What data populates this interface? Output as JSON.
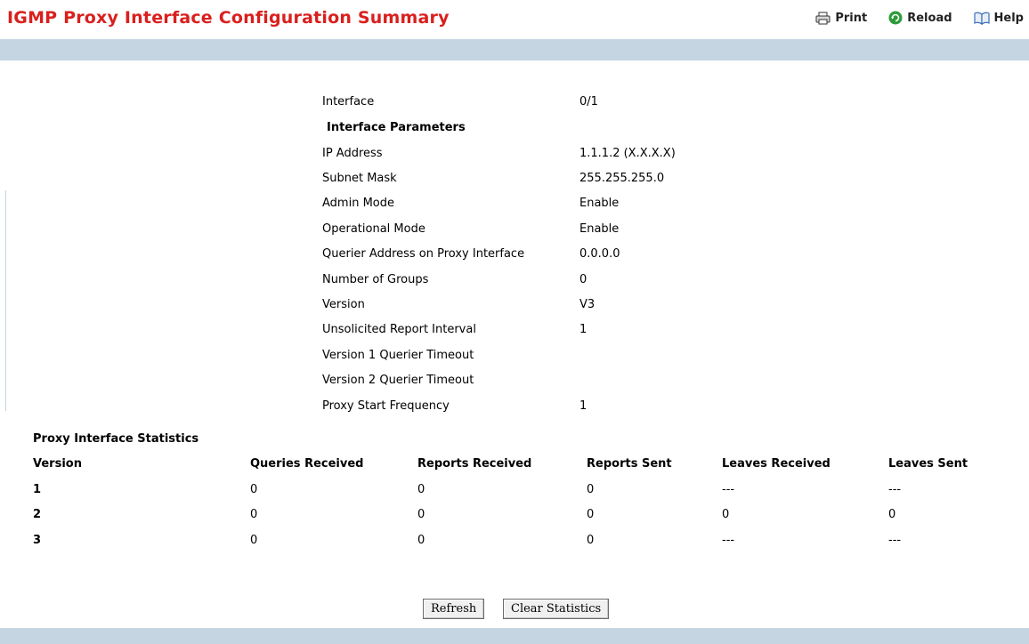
{
  "page": {
    "title": "IGMP Proxy Interface Configuration Summary"
  },
  "toolbar": {
    "print_label": "Print",
    "reload_label": "Reload",
    "help_label": "Help"
  },
  "config": {
    "interface": {
      "label": "Interface",
      "value": "0/1"
    },
    "section_title": "Interface Parameters",
    "rows": [
      {
        "label": "IP Address",
        "value": "1.1.1.2  (X.X.X.X)"
      },
      {
        "label": "Subnet Mask",
        "value": "255.255.255.0"
      },
      {
        "label": "Admin Mode",
        "value": "Enable"
      },
      {
        "label": "Operational Mode",
        "value": "Enable"
      },
      {
        "label": "Querier Address on Proxy Interface",
        "value": "0.0.0.0"
      },
      {
        "label": "Number of Groups",
        "value": "0"
      },
      {
        "label": "Version",
        "value": "V3"
      },
      {
        "label": "Unsolicited Report Interval",
        "value": "1"
      },
      {
        "label": "Version 1 Querier Timeout",
        "value": ""
      },
      {
        "label": "Version 2 Querier Timeout",
        "value": ""
      },
      {
        "label": "Proxy Start Frequency",
        "value": "1"
      }
    ]
  },
  "stats": {
    "title": "Proxy Interface Statistics",
    "headers": [
      "Version",
      "Queries Received",
      "Reports Received",
      "Reports Sent",
      "Leaves Received",
      "Leaves Sent"
    ],
    "rows": [
      [
        "1",
        "0",
        "0",
        "0",
        "---",
        "---"
      ],
      [
        "2",
        "0",
        "0",
        "0",
        "0",
        "0"
      ],
      [
        "3",
        "0",
        "0",
        "0",
        "---",
        "---"
      ]
    ]
  },
  "buttons": {
    "refresh_label": "Refresh",
    "clear_label": "Clear Statistics"
  },
  "colors": {
    "title": "#d9201e",
    "bar": "#c5d5e1",
    "reload_icon": "#2e9b3a",
    "help_icon": "#3a6fb5"
  },
  "icons": {
    "print": "printer-icon",
    "reload": "reload-icon",
    "help": "book-icon"
  }
}
